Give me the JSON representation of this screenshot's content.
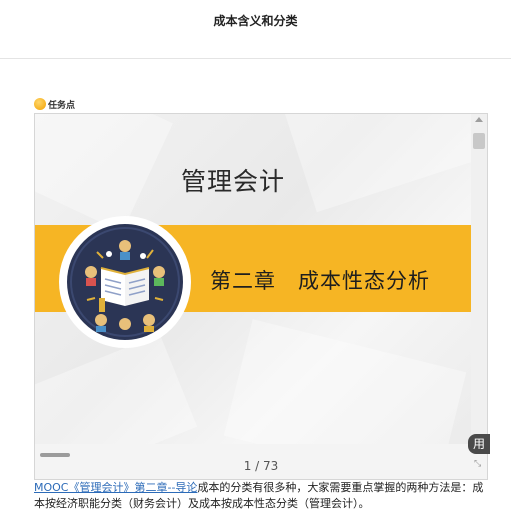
{
  "page": {
    "title": "成本含义和分类"
  },
  "task": {
    "label": "任务点",
    "icon": "task-point-icon"
  },
  "viewer": {
    "slide": {
      "title": "管理会计",
      "chapter": "第二章　成本性态分析",
      "emblem_icon": "book-and-people-icon",
      "colors": {
        "band": "#f6b524",
        "emblem_bg": "#2b3555"
      }
    },
    "page_indicator": "1 / 73",
    "side_tab_label": "用",
    "fullscreen_icon": "⤡"
  },
  "description": {
    "link_text": "MOOC《管理会计》第二章--导论",
    "text": "成本的分类有很多种，大家需要重点掌握的两种方法是：成本按经济职能分类（财务会计）及成本按成本性态分类（管理会计）。"
  }
}
